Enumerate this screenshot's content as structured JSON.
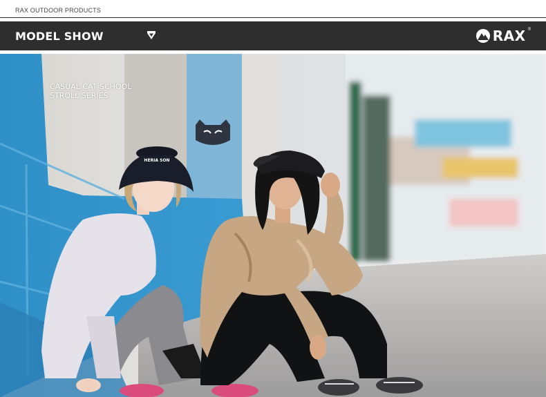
{
  "header": {
    "breadcrumb": "RAX OUTDOOR PRODUCTS"
  },
  "section_bar": {
    "title": "MODEL SHOW",
    "brand": "RAX",
    "brand_mark": "®"
  },
  "photo": {
    "caption_line1": "CASUAL CAT SCHOOL",
    "caption_line2": "STROLL SERIES",
    "cap_text": "HERIA SON"
  },
  "icons": {
    "chevron": "chevron-down-shield-icon",
    "logo": "rax-mountain-logo-icon"
  },
  "colors": {
    "bar_bg": "#2e2e2e",
    "wall_blue": "#2f8fc7",
    "sky_blue": "#4fa6d3"
  }
}
